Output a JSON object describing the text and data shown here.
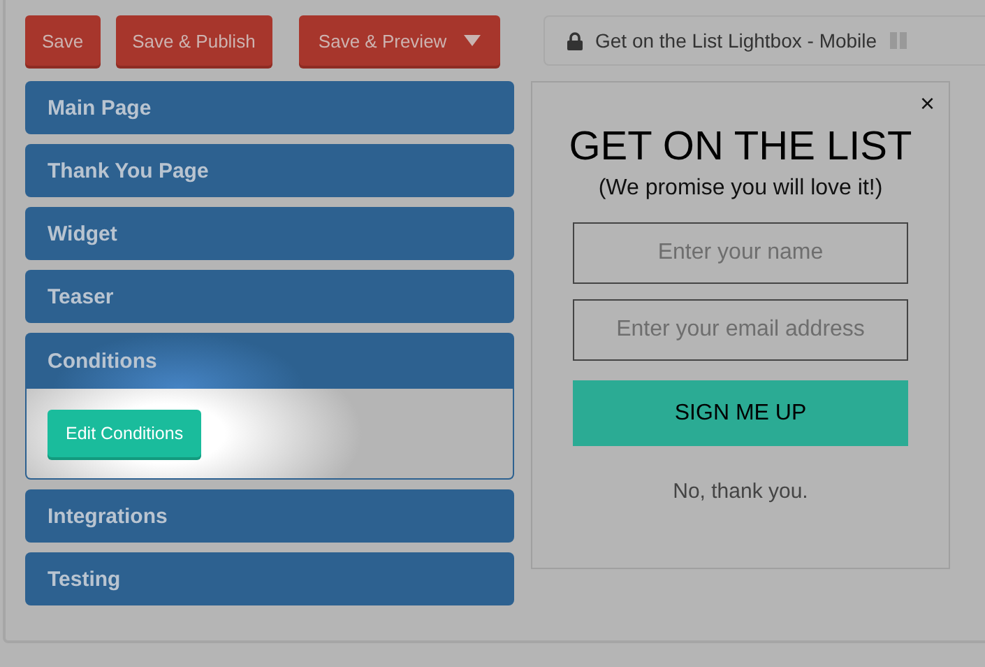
{
  "toolbar": {
    "buttons": [
      {
        "label": "Save",
        "kind": "plain"
      },
      {
        "label": "Save & Publish",
        "kind": "plain"
      },
      {
        "label": "Save & Preview",
        "kind": "dropdown"
      }
    ]
  },
  "sections": [
    {
      "label": "Main Page",
      "expanded": false
    },
    {
      "label": "Thank You Page",
      "expanded": false
    },
    {
      "label": "Widget",
      "expanded": false
    },
    {
      "label": "Teaser",
      "expanded": false
    },
    {
      "label": "Conditions",
      "expanded": true,
      "action": "Edit Conditions"
    },
    {
      "label": "Integrations",
      "expanded": false
    },
    {
      "label": "Testing",
      "expanded": false
    }
  ],
  "preview": {
    "title": "Get on the List Lightbox - Mobile",
    "locked": true,
    "popup": {
      "close": "×",
      "heading": "GET ON THE LIST",
      "subheading": "(We promise you will love it!)",
      "fields": [
        {
          "placeholder": "Enter your name"
        },
        {
          "placeholder": "Enter your email address"
        }
      ],
      "submit": "SIGN ME UP",
      "decline": "No, thank you."
    }
  }
}
